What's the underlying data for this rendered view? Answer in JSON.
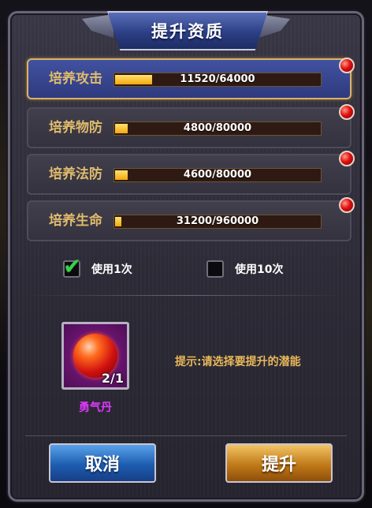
{
  "dialog": {
    "title": "提升资质",
    "stats": [
      {
        "label": "培养攻击",
        "value_text": "11520/64000",
        "progress": 0.18,
        "selected": true
      },
      {
        "label": "培养物防",
        "value_text": "4800/80000",
        "progress": 0.06,
        "selected": false
      },
      {
        "label": "培养法防",
        "value_text": "4600/80000",
        "progress": 0.06,
        "selected": false
      },
      {
        "label": "培养生命",
        "value_text": "31200/960000",
        "progress": 0.03,
        "selected": false
      }
    ],
    "options": {
      "use_once": {
        "label": "使用1次",
        "checked": true
      },
      "use_ten": {
        "label": "使用10次",
        "checked": false
      }
    },
    "item": {
      "name": "勇气丹",
      "count": "2/1",
      "icon": "red-orb-icon"
    },
    "hint": "提示:请选择要提升的潜能",
    "buttons": {
      "cancel": "取消",
      "upgrade": "提升"
    },
    "colors": {
      "accent_gold": "#e0bb6c",
      "bar_fill": "#f5a80e",
      "item_name": "#e038ff"
    }
  }
}
